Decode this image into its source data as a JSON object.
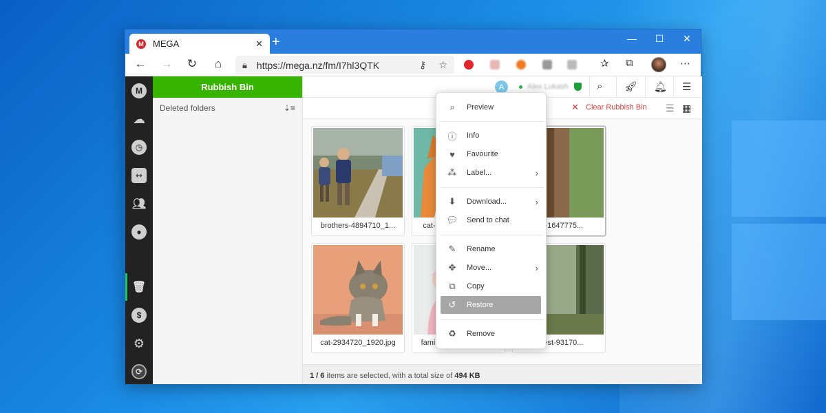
{
  "browser": {
    "tab_title": "MEGA",
    "tab_icon_letter": "M",
    "url": "https://mega.nz/fm/I7hl3QTK"
  },
  "sidebar": {
    "header": "Rubbish Bin",
    "deleted_folders": "Deleted folders"
  },
  "topbar": {
    "avatar_letter": "A",
    "username": "Alex Lukash"
  },
  "subbar": {
    "clear_label": "Clear Rubbish Bin"
  },
  "files": [
    {
      "name": "brothers-4894710_1..."
    },
    {
      "name": "cat-323262_1920.jpg"
    },
    {
      "name": "cat-1647775..."
    },
    {
      "name": "cat-2934720_1920.jpg"
    },
    {
      "name": "family-4962871_192..."
    },
    {
      "name": "forest-93170..."
    }
  ],
  "status": {
    "prefix": "1 / 6",
    "middle": " items are selected, with a total size of ",
    "size": "494 KB"
  },
  "context_menu": {
    "preview": "Preview",
    "info": "Info",
    "favourite": "Favourite",
    "label": "Label...",
    "download": "Download...",
    "send_to_chat": "Send to chat",
    "rename": "Rename",
    "move": "Move...",
    "copy": "Copy",
    "restore": "Restore",
    "remove": "Remove"
  },
  "colors": {
    "accent_green": "#37b400",
    "mega_red": "#d9272e",
    "danger": "#e23b3b"
  }
}
